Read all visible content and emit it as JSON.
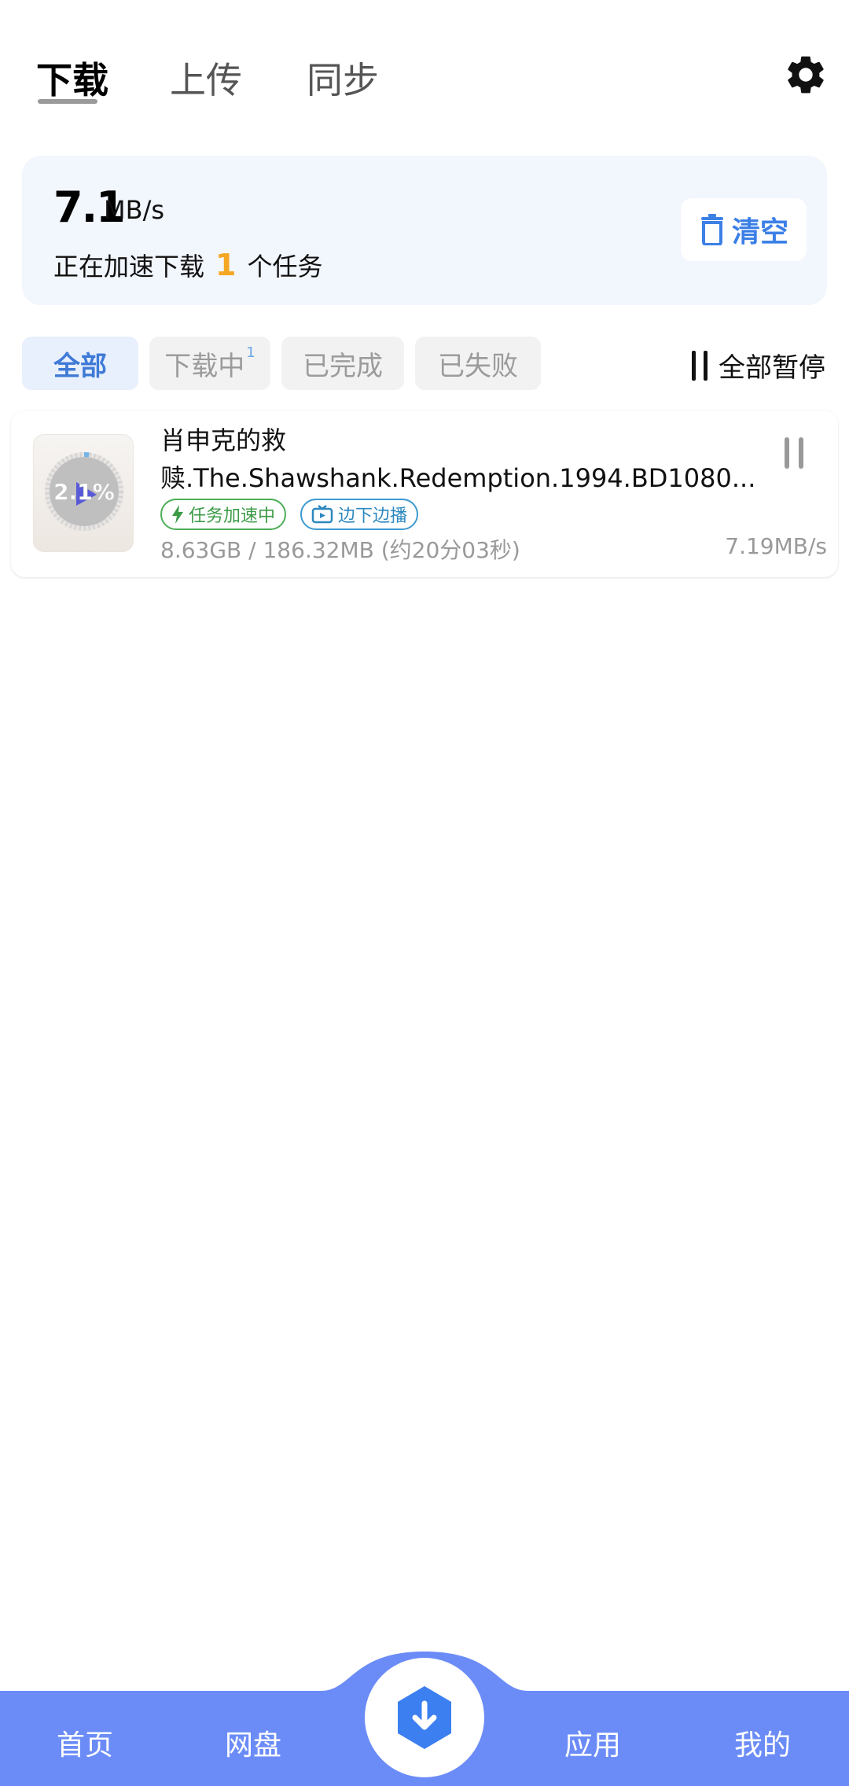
{
  "tabs": [
    {
      "label": "下载",
      "active": true
    },
    {
      "label": "上传",
      "active": false
    },
    {
      "label": "同步",
      "active": false
    }
  ],
  "icons": {
    "settings": "gear-icon",
    "clear": "trash-icon",
    "pause_all": "pause-icon",
    "boost": "lightning-icon",
    "play_while_download": "tv-icon",
    "fab": "download-arrow-icon"
  },
  "speed_card": {
    "speed_value": "7.1",
    "speed_unit": "MB/s",
    "desc_prefix": "正在加速下载",
    "task_count": "1",
    "desc_suffix": "个任务",
    "clear_label": "清空"
  },
  "filters": [
    {
      "label": "全部",
      "active": true
    },
    {
      "label": "下载中",
      "badge": "1",
      "active": false
    },
    {
      "label": "已完成",
      "active": false
    },
    {
      "label": "已失败",
      "active": false
    }
  ],
  "pause_all_label": "全部暂停",
  "task": {
    "title_line1": "肖申克的救",
    "title_line2": "赎.The.Shawshank.Redemption.1994.BD1080...",
    "progress_percent": "2.1%",
    "progress_value": 0.021,
    "badge_boost": "任务加速中",
    "badge_play": "边下边播",
    "size_text": "8.63GB / 186.32MB (约20分03秒)",
    "speed_text": "7.19MB/s"
  },
  "bottom_nav": {
    "home": "首页",
    "disk": "网盘",
    "apps": "应用",
    "me": "我的"
  },
  "colors": {
    "accent": "#3c80e6",
    "nav_bg": "#6b8cf7",
    "task_count": "#f5a623",
    "boost_green": "#4cae57",
    "play_blue": "#3d9ad1"
  }
}
